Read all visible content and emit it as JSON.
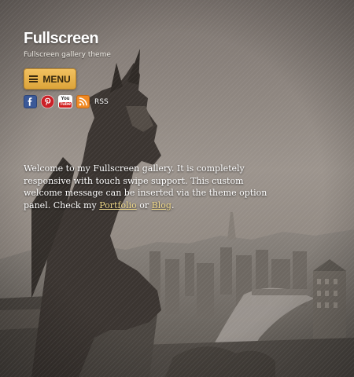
{
  "site": {
    "title": "Fullscreen",
    "tagline": "Fullscreen gallery theme"
  },
  "menu": {
    "label": "MENU",
    "icon": "hamburger-icon",
    "accent_color": "#e8b24b"
  },
  "social": {
    "icons": [
      "facebook-icon",
      "pinterest-icon",
      "youtube-icon",
      "rss-icon"
    ],
    "youtube_top": "You",
    "youtube_bottom": "Tube",
    "rss_label": "RSS"
  },
  "welcome": {
    "text_before": "Welcome to my Fullscreen gallery. It is completely responsive with touch swipe support. This custom welcome message can be inserted via the theme option panel. Check my ",
    "portfolio_link": "Portfolio",
    "text_middle": " or ",
    "blog_link": "Blog",
    "text_after": ".",
    "link_color": "#f0d98a"
  }
}
